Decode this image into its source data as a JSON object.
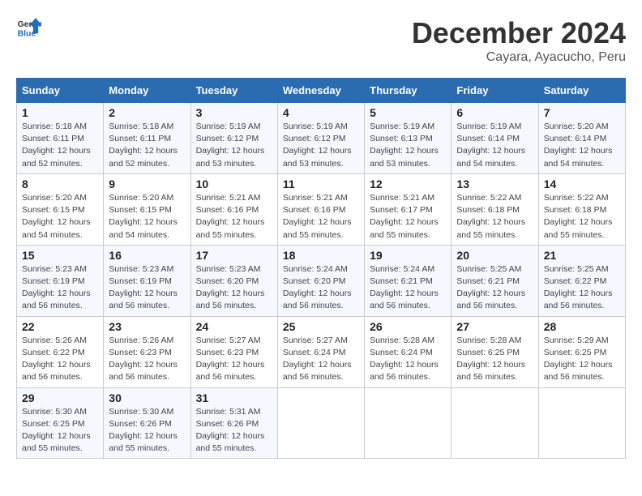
{
  "logo": {
    "line1": "General",
    "line2": "Blue"
  },
  "title": "December 2024",
  "subtitle": "Cayara, Ayacucho, Peru",
  "days_of_week": [
    "Sunday",
    "Monday",
    "Tuesday",
    "Wednesday",
    "Thursday",
    "Friday",
    "Saturday"
  ],
  "weeks": [
    [
      {
        "day": "1",
        "info": "Sunrise: 5:18 AM\nSunset: 6:11 PM\nDaylight: 12 hours\nand 52 minutes."
      },
      {
        "day": "2",
        "info": "Sunrise: 5:18 AM\nSunset: 6:11 PM\nDaylight: 12 hours\nand 52 minutes."
      },
      {
        "day": "3",
        "info": "Sunrise: 5:19 AM\nSunset: 6:12 PM\nDaylight: 12 hours\nand 53 minutes."
      },
      {
        "day": "4",
        "info": "Sunrise: 5:19 AM\nSunset: 6:12 PM\nDaylight: 12 hours\nand 53 minutes."
      },
      {
        "day": "5",
        "info": "Sunrise: 5:19 AM\nSunset: 6:13 PM\nDaylight: 12 hours\nand 53 minutes."
      },
      {
        "day": "6",
        "info": "Sunrise: 5:19 AM\nSunset: 6:14 PM\nDaylight: 12 hours\nand 54 minutes."
      },
      {
        "day": "7",
        "info": "Sunrise: 5:20 AM\nSunset: 6:14 PM\nDaylight: 12 hours\nand 54 minutes."
      }
    ],
    [
      {
        "day": "8",
        "info": "Sunrise: 5:20 AM\nSunset: 6:15 PM\nDaylight: 12 hours\nand 54 minutes."
      },
      {
        "day": "9",
        "info": "Sunrise: 5:20 AM\nSunset: 6:15 PM\nDaylight: 12 hours\nand 54 minutes."
      },
      {
        "day": "10",
        "info": "Sunrise: 5:21 AM\nSunset: 6:16 PM\nDaylight: 12 hours\nand 55 minutes."
      },
      {
        "day": "11",
        "info": "Sunrise: 5:21 AM\nSunset: 6:16 PM\nDaylight: 12 hours\nand 55 minutes."
      },
      {
        "day": "12",
        "info": "Sunrise: 5:21 AM\nSunset: 6:17 PM\nDaylight: 12 hours\nand 55 minutes."
      },
      {
        "day": "13",
        "info": "Sunrise: 5:22 AM\nSunset: 6:18 PM\nDaylight: 12 hours\nand 55 minutes."
      },
      {
        "day": "14",
        "info": "Sunrise: 5:22 AM\nSunset: 6:18 PM\nDaylight: 12 hours\nand 55 minutes."
      }
    ],
    [
      {
        "day": "15",
        "info": "Sunrise: 5:23 AM\nSunset: 6:19 PM\nDaylight: 12 hours\nand 56 minutes."
      },
      {
        "day": "16",
        "info": "Sunrise: 5:23 AM\nSunset: 6:19 PM\nDaylight: 12 hours\nand 56 minutes."
      },
      {
        "day": "17",
        "info": "Sunrise: 5:23 AM\nSunset: 6:20 PM\nDaylight: 12 hours\nand 56 minutes."
      },
      {
        "day": "18",
        "info": "Sunrise: 5:24 AM\nSunset: 6:20 PM\nDaylight: 12 hours\nand 56 minutes."
      },
      {
        "day": "19",
        "info": "Sunrise: 5:24 AM\nSunset: 6:21 PM\nDaylight: 12 hours\nand 56 minutes."
      },
      {
        "day": "20",
        "info": "Sunrise: 5:25 AM\nSunset: 6:21 PM\nDaylight: 12 hours\nand 56 minutes."
      },
      {
        "day": "21",
        "info": "Sunrise: 5:25 AM\nSunset: 6:22 PM\nDaylight: 12 hours\nand 56 minutes."
      }
    ],
    [
      {
        "day": "22",
        "info": "Sunrise: 5:26 AM\nSunset: 6:22 PM\nDaylight: 12 hours\nand 56 minutes."
      },
      {
        "day": "23",
        "info": "Sunrise: 5:26 AM\nSunset: 6:23 PM\nDaylight: 12 hours\nand 56 minutes."
      },
      {
        "day": "24",
        "info": "Sunrise: 5:27 AM\nSunset: 6:23 PM\nDaylight: 12 hours\nand 56 minutes."
      },
      {
        "day": "25",
        "info": "Sunrise: 5:27 AM\nSunset: 6:24 PM\nDaylight: 12 hours\nand 56 minutes."
      },
      {
        "day": "26",
        "info": "Sunrise: 5:28 AM\nSunset: 6:24 PM\nDaylight: 12 hours\nand 56 minutes."
      },
      {
        "day": "27",
        "info": "Sunrise: 5:28 AM\nSunset: 6:25 PM\nDaylight: 12 hours\nand 56 minutes."
      },
      {
        "day": "28",
        "info": "Sunrise: 5:29 AM\nSunset: 6:25 PM\nDaylight: 12 hours\nand 56 minutes."
      }
    ],
    [
      {
        "day": "29",
        "info": "Sunrise: 5:30 AM\nSunset: 6:25 PM\nDaylight: 12 hours\nand 55 minutes."
      },
      {
        "day": "30",
        "info": "Sunrise: 5:30 AM\nSunset: 6:26 PM\nDaylight: 12 hours\nand 55 minutes."
      },
      {
        "day": "31",
        "info": "Sunrise: 5:31 AM\nSunset: 6:26 PM\nDaylight: 12 hours\nand 55 minutes."
      },
      null,
      null,
      null,
      null
    ]
  ]
}
